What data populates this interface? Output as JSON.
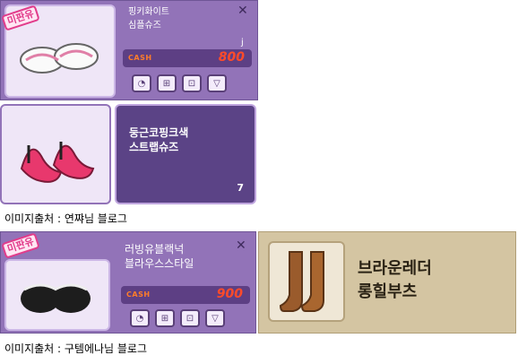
{
  "item1": {
    "badge": "미판유",
    "name_line1": "핑키화이트",
    "name_line2": "심플슈즈",
    "mark": "j",
    "cash_label": "CASH",
    "price": "800",
    "buttons": [
      "try-on",
      "gift",
      "wish",
      "cart"
    ]
  },
  "item2": {
    "name_line1": "둥근코핑크색",
    "name_line2": "스트랩슈즈",
    "count": "7"
  },
  "caption1": "이미지출처 : 연쨔님 블로그",
  "item3": {
    "badge": "미판유",
    "name_line1": "러빙유블랙넉",
    "name_line2": "블라우스스타일",
    "cash_label": "CASH",
    "price": "900"
  },
  "item4": {
    "name_line1": "브라운레더",
    "name_line2": "롱힐부츠"
  },
  "caption2": "이미지출처 : 구템에나님 블로그",
  "colors": {
    "panel": "#9273b8",
    "price": "#ff4b2a",
    "badge": "#e23c8b"
  }
}
